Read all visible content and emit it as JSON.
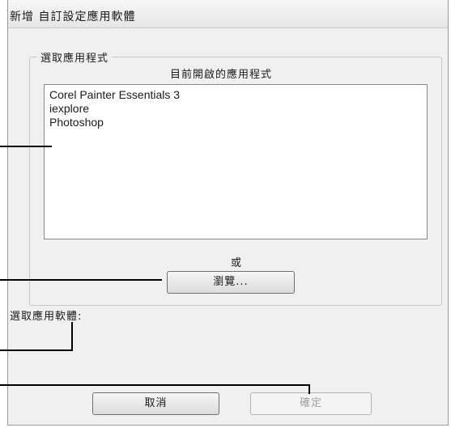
{
  "dialog": {
    "title": "新增 自訂設定應用軟體",
    "group_label": "選取應用程式",
    "list_caption": "目前開啟的應用程式",
    "apps": [
      "Corel Painter Essentials 3",
      "iexplore",
      "Photoshop"
    ],
    "or_text": "或",
    "browse_button": "瀏覽...",
    "selected_app_label": "選取應用軟體:",
    "cancel_button": "取消",
    "ok_button": "確定"
  }
}
